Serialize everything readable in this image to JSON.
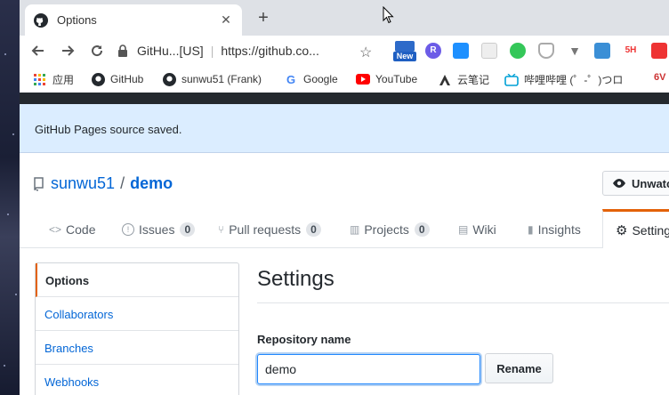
{
  "browser": {
    "tab_title": "Options",
    "close_glyph": "✕",
    "new_tab_glyph": "+",
    "site_name": "GitHu...[US]",
    "url": "https://github.co...",
    "new_badge": "New",
    "ext_r": "R",
    "ext_5h": "5H",
    "ext_6v": "6V"
  },
  "bookmarks": [
    {
      "label": "应用",
      "icon": "apps-grid-icon"
    },
    {
      "label": "GitHub",
      "icon": "github-icon"
    },
    {
      "label": "sunwu51 (Frank)",
      "icon": "github-icon"
    },
    {
      "label": "Google",
      "icon": "google-icon"
    },
    {
      "label": "YouTube",
      "icon": "youtube-icon"
    },
    {
      "label": "云笔记",
      "icon": "note-icon"
    },
    {
      "label": "哔哩哔哩 (゜-゜)つロ",
      "icon": "bilibili-icon"
    }
  ],
  "flash": {
    "message": "GitHub Pages source saved."
  },
  "repo": {
    "owner": "sunwu51",
    "slash": "/",
    "name": "demo",
    "watch_label": "Unwatc"
  },
  "repo_nav": [
    {
      "label": "Code",
      "icon": "<>"
    },
    {
      "label": "Issues",
      "icon": "!",
      "count": "0"
    },
    {
      "label": "Pull requests",
      "icon": "⑂",
      "count": "0"
    },
    {
      "label": "Projects",
      "icon": "▥",
      "count": "0"
    },
    {
      "label": "Wiki",
      "icon": "▤"
    },
    {
      "label": "Insights",
      "icon": "▮"
    },
    {
      "label": "Settings",
      "icon": "⚙"
    }
  ],
  "settings_menu": [
    "Options",
    "Collaborators",
    "Branches",
    "Webhooks"
  ],
  "settings": {
    "title": "Settings",
    "repo_name_label": "Repository name",
    "repo_name_value": "demo",
    "rename_label": "Rename"
  },
  "colors": {
    "accent_orange": "#e36209",
    "link_blue": "#0366d6",
    "flash_bg": "#dbedff",
    "header_dark": "#24292e"
  }
}
